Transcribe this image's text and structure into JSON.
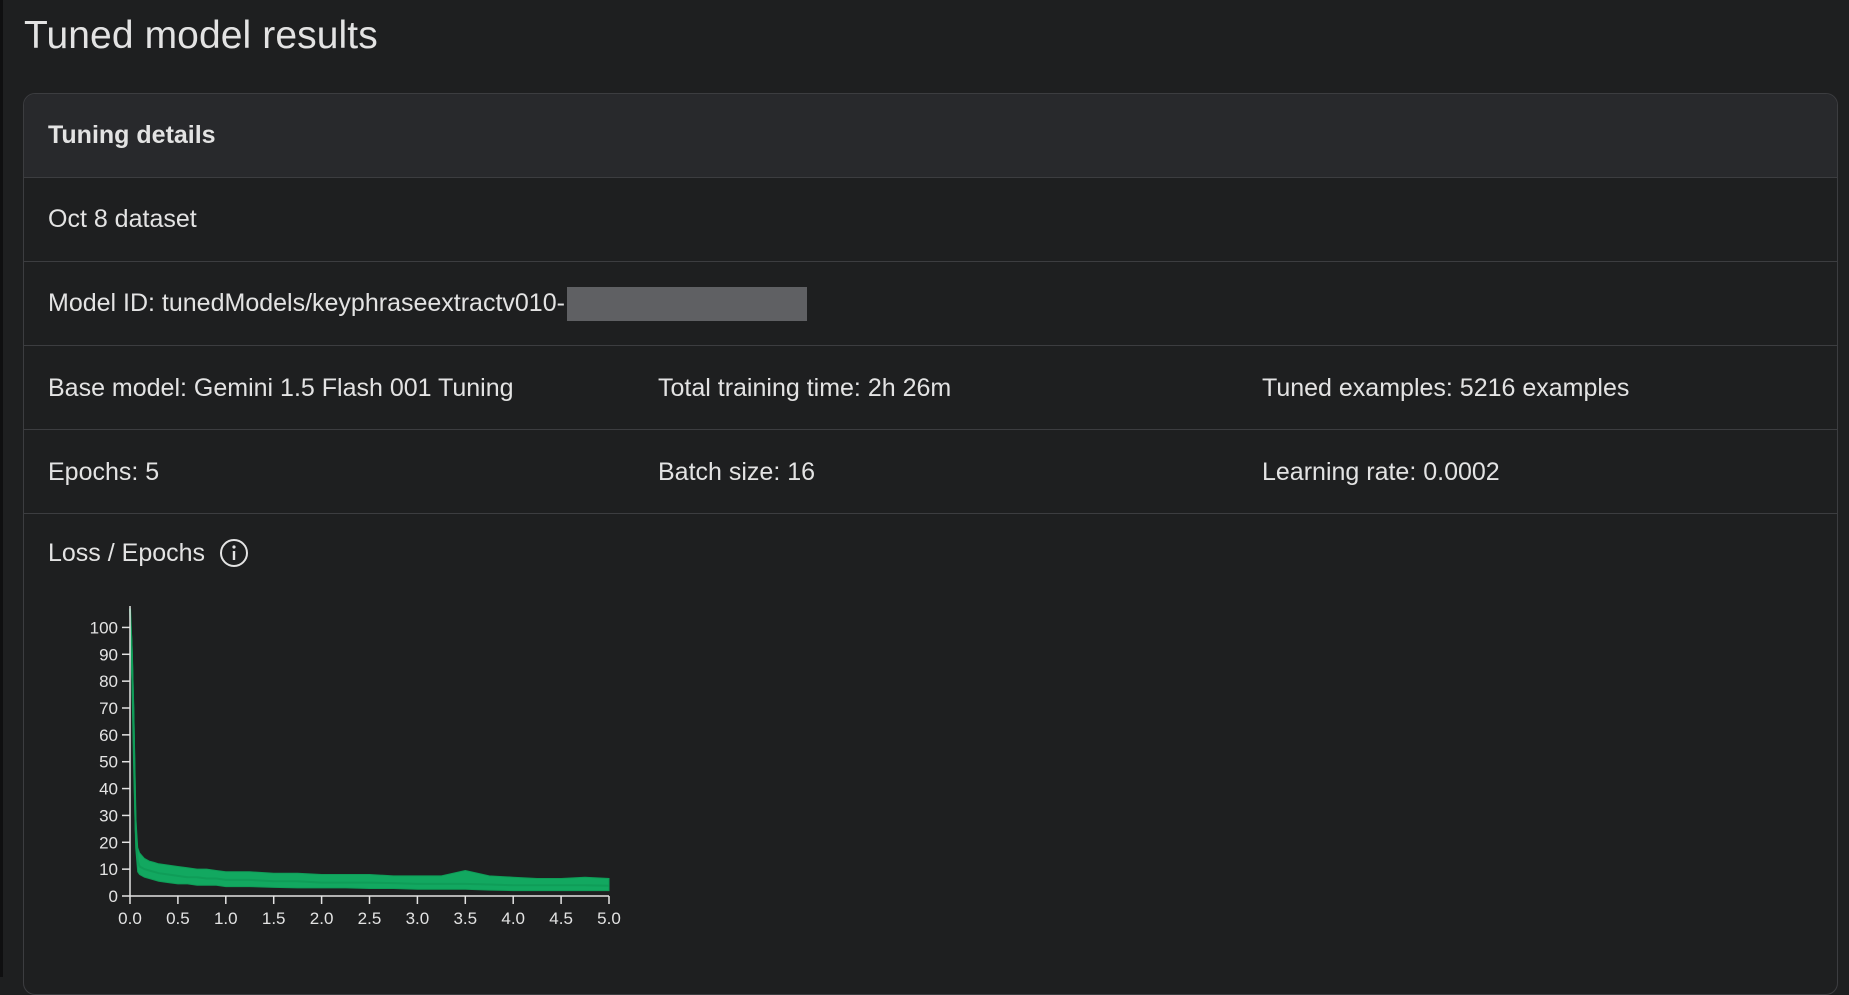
{
  "page": {
    "title": "Tuned model results"
  },
  "card": {
    "header": "Tuning details",
    "dataset": "Oct 8 dataset",
    "model_id_label": "Model ID: tunedModels/keyphraseextractv010-",
    "base_model": "Base model: Gemini 1.5 Flash 001 Tuning",
    "training_time": "Total training time: 2h 26m",
    "tuned_examples": "Tuned examples: 5216 examples",
    "epochs": "Epochs: 5",
    "batch_size": "Batch size: 16",
    "learning_rate": "Learning rate: 0.0002",
    "loss_title": "Loss / Epochs"
  },
  "colors": {
    "line": "#0f9d58",
    "fill": "#12a860"
  },
  "icons": {
    "info": "info-icon"
  },
  "chart_data": {
    "type": "area",
    "title": "",
    "xlabel": "",
    "ylabel": "",
    "xlim": [
      0,
      5
    ],
    "ylim": [
      0,
      105
    ],
    "xticks": [
      "0.0",
      "0.5",
      "1.0",
      "1.5",
      "2.0",
      "2.5",
      "3.0",
      "3.5",
      "4.0",
      "4.5",
      "5.0"
    ],
    "yticks": [
      "0",
      "10",
      "20",
      "30",
      "40",
      "50",
      "60",
      "70",
      "80",
      "90",
      "100"
    ],
    "grid": false,
    "series": [
      {
        "x": [
          0.0,
          0.02,
          0.04,
          0.06,
          0.08,
          0.1,
          0.15,
          0.2,
          0.25,
          0.3,
          0.4,
          0.5,
          0.6,
          0.7,
          0.8,
          0.9,
          1.0,
          1.25,
          1.5,
          1.75,
          2.0,
          2.25,
          2.5,
          2.75,
          3.0,
          3.25,
          3.5,
          3.75,
          4.0,
          4.25,
          4.5,
          4.75,
          5.0
        ],
        "values": [
          107,
          90,
          60,
          25,
          13,
          11,
          10,
          9.5,
          9,
          8.5,
          8,
          7.5,
          7,
          7,
          6.5,
          6.5,
          6,
          6,
          5.5,
          5.5,
          5,
          5,
          5,
          4.8,
          4.5,
          4.5,
          4.5,
          4.3,
          4,
          4,
          4,
          4,
          3.8
        ],
        "upper": [
          107,
          95,
          70,
          30,
          18,
          16,
          14,
          13,
          12.5,
          12,
          11.5,
          11,
          10.5,
          10,
          10,
          9.5,
          9,
          9,
          8.5,
          8.5,
          8,
          8,
          8,
          7.5,
          7.5,
          7.5,
          9.5,
          7.5,
          7,
          6.5,
          6.5,
          7,
          6.5
        ],
        "lower": [
          100,
          80,
          45,
          18,
          9,
          8,
          7,
          6.5,
          6,
          5.5,
          5,
          4.5,
          4.5,
          4,
          4,
          4,
          3.5,
          3.5,
          3.2,
          3,
          3,
          3,
          2.8,
          2.8,
          2.5,
          2.5,
          2.5,
          2.2,
          2,
          2,
          2,
          2,
          2
        ]
      }
    ]
  }
}
